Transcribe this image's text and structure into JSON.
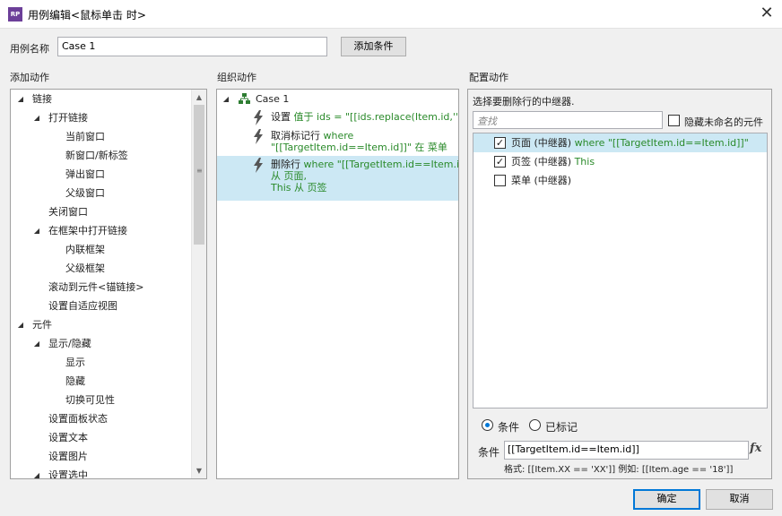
{
  "window": {
    "app_icon": "RP",
    "title": "用例编辑<鼠标单击 时>",
    "close_glyph": "✕"
  },
  "case_name": {
    "label": "用例名称",
    "value": "Case 1",
    "add_condition_button": "添加条件"
  },
  "add_actions": {
    "header": "添加动作",
    "tree": [
      {
        "label": "链接",
        "level": 0,
        "caret": "◢"
      },
      {
        "label": "打开链接",
        "level": 1,
        "caret": "◢"
      },
      {
        "label": "当前窗口",
        "level": 2
      },
      {
        "label": "新窗口/新标签",
        "level": 2
      },
      {
        "label": "弹出窗口",
        "level": 2
      },
      {
        "label": "父级窗口",
        "level": 2
      },
      {
        "label": "关闭窗口",
        "level": 1
      },
      {
        "label": "在框架中打开链接",
        "level": 1,
        "caret": "◢"
      },
      {
        "label": "内联框架",
        "level": 2
      },
      {
        "label": "父级框架",
        "level": 2
      },
      {
        "label": "滚动到元件<锚链接>",
        "level": 1
      },
      {
        "label": "设置自适应视图",
        "level": 1
      },
      {
        "label": "元件",
        "level": 0,
        "caret": "◢"
      },
      {
        "label": "显示/隐藏",
        "level": 1,
        "caret": "◢"
      },
      {
        "label": "显示",
        "level": 2
      },
      {
        "label": "隐藏",
        "level": 2
      },
      {
        "label": "切换可见性",
        "level": 2
      },
      {
        "label": "设置面板状态",
        "level": 1
      },
      {
        "label": "设置文本",
        "level": 1
      },
      {
        "label": "设置图片",
        "level": 1
      },
      {
        "label": "设置选中",
        "level": 1,
        "caret": "◢"
      }
    ],
    "scroll_up": "▲",
    "scroll_down": "▼",
    "scroll_grip": "≡"
  },
  "organize_actions": {
    "header": "组织动作",
    "case_label": "Case 1",
    "case_caret": "◢",
    "actions": [
      {
        "verb": "设置",
        "detail_lines": [
          "值于 ids = \"[[ids.replace(Item.id,'')]]\""
        ]
      },
      {
        "verb": "取消标记行",
        "detail_lines": [
          "where",
          "\"[[TargetItem.id==Item.id]]\"  在 菜单"
        ]
      },
      {
        "verb": "删除行",
        "detail_lines": [
          "where \"[[TargetItem.id==Item.id]]\"",
          "从 页面,",
          "This 从 页签"
        ],
        "selected": true
      }
    ]
  },
  "configure_actions": {
    "header": "配置动作",
    "instruction": "选择要删除行的中继器.",
    "search_placeholder": "查找",
    "hide_unnamed_label": "隐藏未命名的元件",
    "hide_unnamed_checked": false,
    "repeaters": [
      {
        "name": "页面 (中继器)",
        "detail": " where \"[[TargetItem.id==Item.id]]\"",
        "checked": true,
        "highlighted": true
      },
      {
        "name": "页签 (中继器)",
        "detail": " This",
        "checked": true,
        "highlighted": false
      },
      {
        "name": "菜单 (中继器)",
        "detail": "",
        "checked": false,
        "highlighted": false
      }
    ],
    "mode_condition": "条件",
    "mode_marked": "已标记",
    "selected_mode": "condition",
    "condition_label": "条件",
    "condition_value": "[[TargetItem.id==Item.id]]",
    "fx_label": "fx",
    "format_hint": "格式: [[Item.XX == 'XX']] 例如: [[Item.age == '18']]"
  },
  "footer": {
    "ok": "确定",
    "cancel": "取消"
  },
  "colors": {
    "green_text": "#2a8a2a",
    "selection": "#cce8f4",
    "case_icon": "#2e7d32",
    "accent": "#0078d7"
  }
}
